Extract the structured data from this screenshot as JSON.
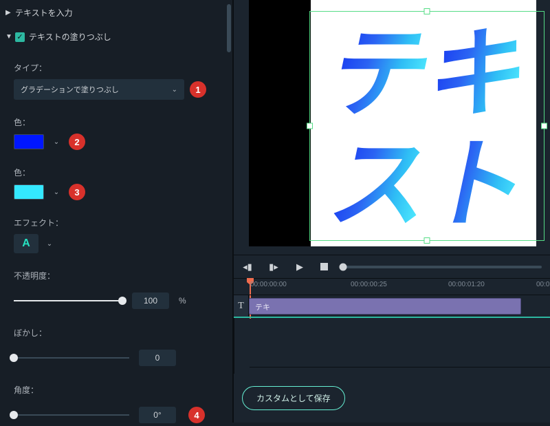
{
  "left": {
    "section1": "テキストを入力",
    "section2": "テキストの塗りつぶし",
    "type_label": "タイプ：",
    "type_value": "グラデーションで塗りつぶし",
    "color_label": "色：",
    "color1": "#0016ff",
    "color2": "#34e8ff",
    "effect_label": "エフェクト：",
    "effect_glyph": "A",
    "opacity_label": "不透明度：",
    "opacity_value": "100",
    "opacity_unit": "%",
    "blur_label": "ぼかし：",
    "blur_value": "0",
    "angle_label": "角度：",
    "angle_value": "0°"
  },
  "markers": {
    "m1": "1",
    "m2": "2",
    "m3": "3",
    "m4": "4"
  },
  "preview_text": [
    "テ",
    "キ",
    "ス",
    "ト"
  ],
  "ruler": {
    "t0": "00:00:00:00",
    "t1": "00:00:00:25",
    "t2": "00:00:01:20",
    "t3": "00:0"
  },
  "timeline": {
    "track_icon": "T",
    "clip_label": "テキ"
  },
  "save_label": "カスタムとして保存"
}
